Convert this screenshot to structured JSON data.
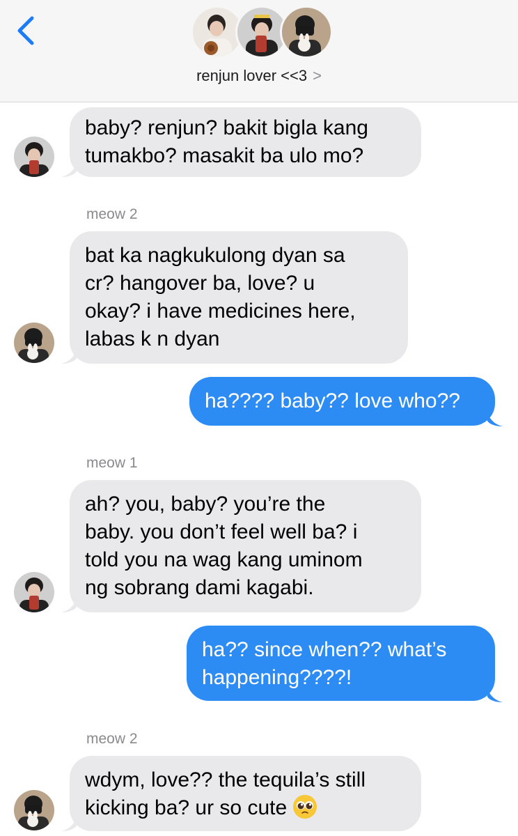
{
  "header": {
    "title": "renjun lover <<3",
    "chevron": ">",
    "back_icon": "chevron-left-icon"
  },
  "colors": {
    "incoming_bubble": "#e9e9eb",
    "outgoing_bubble": "#2d8cf4",
    "accent": "#1b7cf5"
  },
  "messages": [
    {
      "direction": "in",
      "sender": "",
      "lines": [
        "baby? renjun? bakit bigla kang",
        "tumakbo? masakit ba ulo mo?"
      ]
    },
    {
      "direction": "in",
      "sender": "meow 2",
      "lines": [
        "bat ka nagkukulong dyan sa",
        "cr? hangover ba, love? u",
        "okay? i have medicines here,",
        "labas k n dyan"
      ]
    },
    {
      "direction": "out",
      "lines": [
        "ha???? baby?? love who??"
      ]
    },
    {
      "direction": "in",
      "sender": "meow 1",
      "lines": [
        "ah? you, baby? you’re the",
        "baby. you don’t feel well ba? i",
        "told you na wag kang uminom",
        "ng sobrang dami kagabi."
      ]
    },
    {
      "direction": "out",
      "lines": [
        "ha?? since when?? what’s",
        "happening????!"
      ]
    },
    {
      "direction": "in",
      "sender": "meow 2",
      "lines": [
        "wdym, love?? the tequila’s still",
        "kicking ba?  ur so cute"
      ],
      "emoji": "pleading-face-emoji"
    }
  ]
}
